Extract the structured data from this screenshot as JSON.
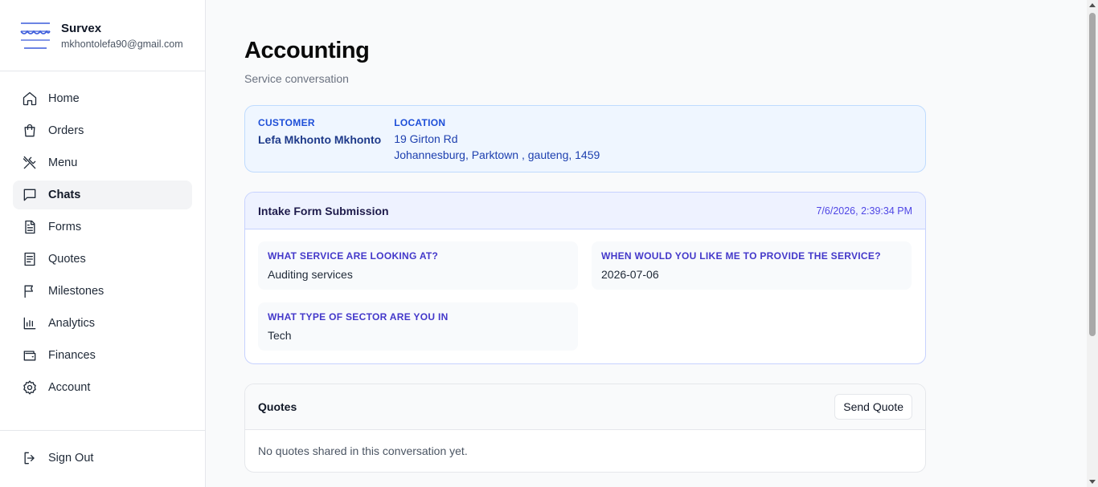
{
  "brand": {
    "name": "Survex",
    "email": "mkhontolefa90@gmail.com",
    "logo_icon": "wave-logo-icon"
  },
  "sidebar": {
    "items": [
      {
        "label": "Home",
        "icon": "home-icon",
        "active": false
      },
      {
        "label": "Orders",
        "icon": "shopping-bag-icon",
        "active": false
      },
      {
        "label": "Menu",
        "icon": "utensils-icon",
        "active": false
      },
      {
        "label": "Chats",
        "icon": "message-square-icon",
        "active": true
      },
      {
        "label": "Forms",
        "icon": "file-text-icon",
        "active": false
      },
      {
        "label": "Quotes",
        "icon": "receipt-icon",
        "active": false
      },
      {
        "label": "Milestones",
        "icon": "flag-icon",
        "active": false
      },
      {
        "label": "Analytics",
        "icon": "bar-chart-icon",
        "active": false
      },
      {
        "label": "Finances",
        "icon": "wallet-icon",
        "active": false
      },
      {
        "label": "Account",
        "icon": "gear-icon",
        "active": false
      }
    ],
    "sign_out": {
      "label": "Sign Out",
      "icon": "log-out-icon"
    }
  },
  "main": {
    "title": "Accounting",
    "subtitle": "Service conversation",
    "customer": {
      "customer_label": "CUSTOMER",
      "customer_name": "Lefa Mkhonto Mkhonto",
      "location_label": "LOCATION",
      "location_line1": "19 Girton Rd",
      "location_line2": "Johannesburg, Parktown , gauteng, 1459"
    },
    "intake": {
      "title": "Intake Form Submission",
      "date": "7/6/2026, 2:39:34 PM",
      "fields": [
        {
          "label": "WHAT SERVICE ARE LOOKING AT?",
          "value": "Auditing services"
        },
        {
          "label": "WHEN WOULD YOU LIKE ME TO PROVIDE THE SERVICE?",
          "value": "2026-07-06"
        },
        {
          "label": "WHAT TYPE OF SECTOR ARE YOU IN",
          "value": "Tech"
        }
      ]
    },
    "quotes": {
      "title": "Quotes",
      "send_label": "Send Quote",
      "empty_text": "No quotes shared in this conversation yet."
    }
  },
  "colors": {
    "customer_bg": "#eff6ff",
    "customer_border": "#bfdbfe",
    "intake_header_bg": "#eef2ff",
    "accent_indigo": "#4338ca",
    "active_nav_bg": "#f3f4f6"
  }
}
